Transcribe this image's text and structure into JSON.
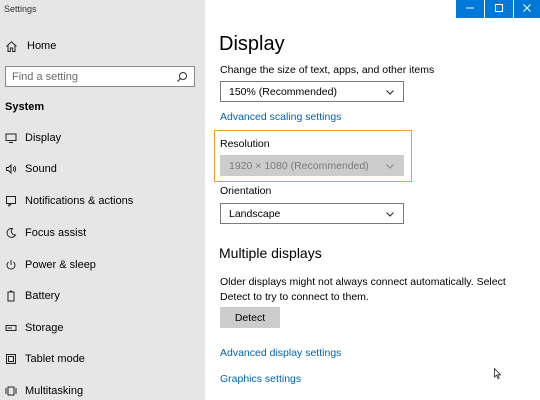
{
  "window": {
    "title": "Settings",
    "accent": "#0078d7"
  },
  "titlebar": {
    "minimize_icon": "minimize-icon",
    "maximize_icon": "maximize-icon",
    "close_icon": "close-icon"
  },
  "sidebar": {
    "home_label": "Home",
    "search_placeholder": "Find a setting",
    "section_heading": "System",
    "items": [
      {
        "label": "Display",
        "icon": "monitor-icon"
      },
      {
        "label": "Sound",
        "icon": "speaker-icon"
      },
      {
        "label": "Notifications & actions",
        "icon": "notification-icon"
      },
      {
        "label": "Focus assist",
        "icon": "moon-icon"
      },
      {
        "label": "Power & sleep",
        "icon": "power-icon"
      },
      {
        "label": "Battery",
        "icon": "battery-icon"
      },
      {
        "label": "Storage",
        "icon": "storage-icon"
      },
      {
        "label": "Tablet mode",
        "icon": "tablet-icon"
      },
      {
        "label": "Multitasking",
        "icon": "multitasking-icon"
      }
    ]
  },
  "main": {
    "title": "Display",
    "scale": {
      "label": "Change the size of text, apps, and other items",
      "value": "150% (Recommended)"
    },
    "advanced_scaling_link": "Advanced scaling settings",
    "resolution": {
      "label": "Resolution",
      "value": "1920 × 1080 (Recommended)",
      "highlight_color": "#f0a030"
    },
    "orientation": {
      "label": "Orientation",
      "value": "Landscape"
    },
    "multiple_displays": {
      "heading": "Multiple displays",
      "description": "Older displays might not always connect automatically. Select Detect to try to connect to them.",
      "detect_button": "Detect"
    },
    "advanced_display_link": "Advanced display settings",
    "graphics_link": "Graphics settings",
    "link_color": "#0063b1"
  }
}
